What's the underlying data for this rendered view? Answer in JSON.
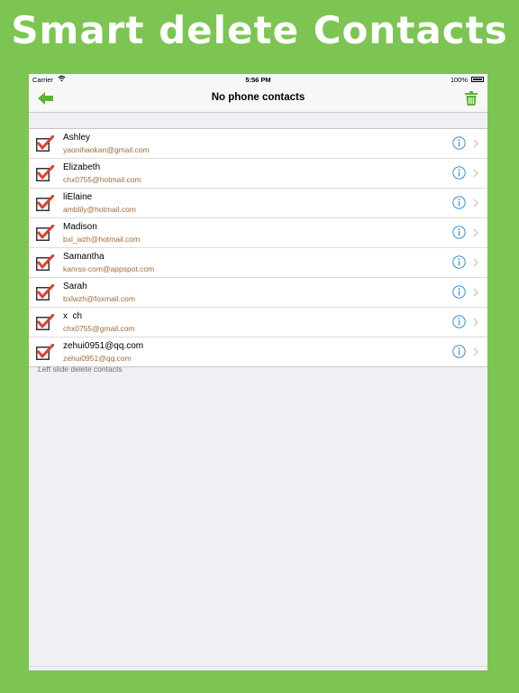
{
  "banner": {
    "title": "Smart delete Contacts"
  },
  "status_bar": {
    "carrier": "Carrier",
    "time": "5:56 PM",
    "battery": "100%"
  },
  "nav": {
    "title": "No phone contacts"
  },
  "contacts": [
    {
      "name": "Ashley",
      "email": "yaonihaokan@gmail.com",
      "checked": true
    },
    {
      "name": "Elizabeth",
      "email": "chx0755@hotmail.com",
      "checked": true
    },
    {
      "name": "liElaine",
      "email": "amblily@hotmail.com",
      "checked": true
    },
    {
      "name": "Madison",
      "email": "bxl_wzh@hotmail.com",
      "checked": true
    },
    {
      "name": "Samantha",
      "email": "kanrss-com@appspot.com",
      "checked": true
    },
    {
      "name": "Sarah",
      "email": "bxlwzh@foxmail.com",
      "checked": true
    },
    {
      "name": "x  ch",
      "email": "chx0755@gmail.com",
      "checked": true
    },
    {
      "name": "zehui0951@qq.com",
      "email": "zehui0951@qq.com",
      "checked": true
    }
  ],
  "footer": {
    "note": "Left slide delete contacts"
  },
  "colors": {
    "background": "#7cc552",
    "check": "#e0402a",
    "accent": "#3a8fd8",
    "email": "#a36a3c",
    "icon_green": "#5cb531"
  }
}
